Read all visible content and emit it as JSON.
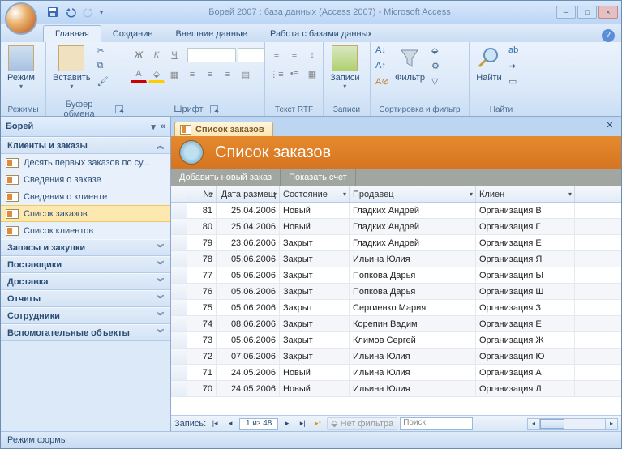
{
  "title": "Борей 2007 : база данных (Access 2007) - Microsoft Access",
  "tabs": [
    "Главная",
    "Создание",
    "Внешние данные",
    "Работа с базами данных"
  ],
  "ribbon": {
    "groups": [
      "Режимы",
      "Буфер обмена",
      "Шрифт",
      "Текст RTF",
      "Записи",
      "Сортировка и фильтр",
      "Найти"
    ],
    "mode_btn": "Режим",
    "paste_btn": "Вставить",
    "records_btn": "Записи",
    "filter_btn": "Фильтр",
    "find_btn": "Найти"
  },
  "nav": {
    "title": "Борей",
    "sections": [
      {
        "name": "Клиенты и заказы",
        "open": true,
        "items": [
          "Десять первых заказов по су...",
          "Сведения о заказе",
          "Сведения о клиенте",
          "Список заказов",
          "Список клиентов"
        ],
        "selected": 3
      },
      {
        "name": "Запасы и закупки",
        "open": false
      },
      {
        "name": "Поставщики",
        "open": false
      },
      {
        "name": "Доставка",
        "open": false
      },
      {
        "name": "Отчеты",
        "open": false
      },
      {
        "name": "Сотрудники",
        "open": false
      },
      {
        "name": "Вспомогательные объекты",
        "open": false
      }
    ]
  },
  "doctab": "Список заказов",
  "form_title": "Список заказов",
  "cmds": [
    "Добавить новый заказ",
    "Показать счет"
  ],
  "cols": [
    "№",
    "Дата размещ",
    "Состояние",
    "Продавец",
    "Клиен"
  ],
  "rows": [
    {
      "n": "81",
      "d": "25.04.2006",
      "s": "Новый",
      "p": "Гладких Андрей",
      "k": "Организация В"
    },
    {
      "n": "80",
      "d": "25.04.2006",
      "s": "Новый",
      "p": "Гладких Андрей",
      "k": "Организация Г"
    },
    {
      "n": "79",
      "d": "23.06.2006",
      "s": "Закрыт",
      "p": "Гладких Андрей",
      "k": "Организация Е"
    },
    {
      "n": "78",
      "d": "05.06.2006",
      "s": "Закрыт",
      "p": "Ильина Юлия",
      "k": "Организация Я"
    },
    {
      "n": "77",
      "d": "05.06.2006",
      "s": "Закрыт",
      "p": "Попкова Дарья",
      "k": "Организация Ы"
    },
    {
      "n": "76",
      "d": "05.06.2006",
      "s": "Закрыт",
      "p": "Попкова Дарья",
      "k": "Организация Ш"
    },
    {
      "n": "75",
      "d": "05.06.2006",
      "s": "Закрыт",
      "p": "Сергиенко Мария",
      "k": "Организация З"
    },
    {
      "n": "74",
      "d": "08.06.2006",
      "s": "Закрыт",
      "p": "Корепин Вадим",
      "k": "Организация Е"
    },
    {
      "n": "73",
      "d": "05.06.2006",
      "s": "Закрыт",
      "p": "Климов Сергей",
      "k": "Организация Ж"
    },
    {
      "n": "72",
      "d": "07.06.2006",
      "s": "Закрыт",
      "p": "Ильина Юлия",
      "k": "Организация Ю"
    },
    {
      "n": "71",
      "d": "24.05.2006",
      "s": "Новый",
      "p": "Ильина Юлия",
      "k": "Организация А"
    },
    {
      "n": "70",
      "d": "24.05.2006",
      "s": "Новый",
      "p": "Ильина Юлия",
      "k": "Организация Л"
    }
  ],
  "recnav": {
    "label": "Запись:",
    "pos": "1 из 48",
    "nofilter": "Нет фильтра",
    "search": "Поиск"
  },
  "status": "Режим формы"
}
